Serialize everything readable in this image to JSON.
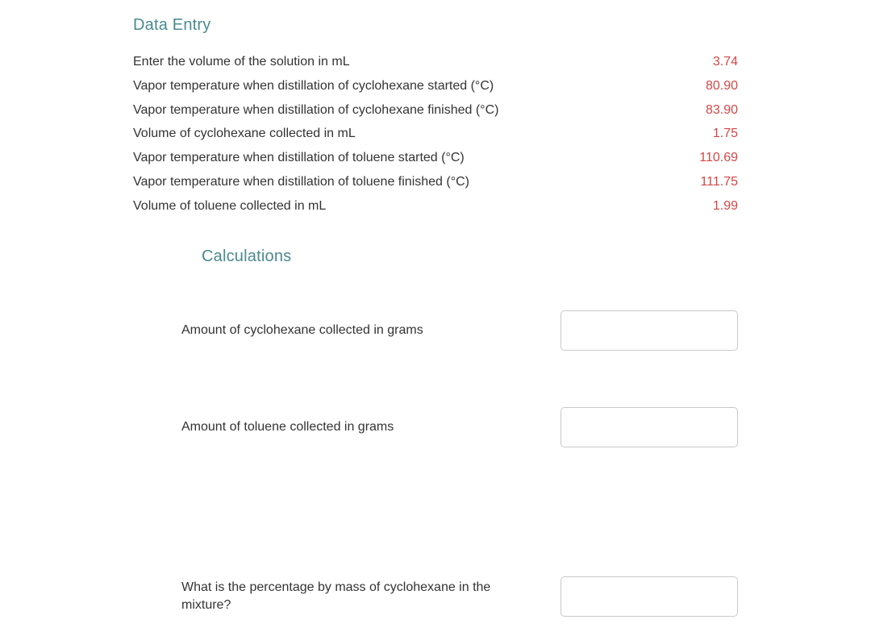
{
  "headings": {
    "data_entry": "Data Entry",
    "calculations": "Calculations"
  },
  "data_rows": [
    {
      "label": "Enter the volume of the solution in mL",
      "value": "3.74"
    },
    {
      "label": "Vapor temperature when distillation of cyclohexane started (°C)",
      "value": "80.90"
    },
    {
      "label": "Vapor temperature when distillation of cyclohexane finished (°C)",
      "value": "83.90"
    },
    {
      "label": "Volume of cyclohexane collected in mL",
      "value": "1.75"
    },
    {
      "label": "Vapor temperature when distillation of toluene started (°C)",
      "value": "110.69"
    },
    {
      "label": "Vapor temperature when distillation of toluene finished (°C)",
      "value": "111.75"
    },
    {
      "label": "Volume of toluene collected in mL",
      "value": "1.99"
    }
  ],
  "calc_rows": {
    "row1": {
      "label": "Amount of cyclohexane collected in grams",
      "value": ""
    },
    "row2": {
      "label": "Amount of toluene collected in grams",
      "value": ""
    },
    "row3": {
      "label": "What is the percentage by mass of cyclohexane in the mixture?",
      "value": ""
    }
  }
}
